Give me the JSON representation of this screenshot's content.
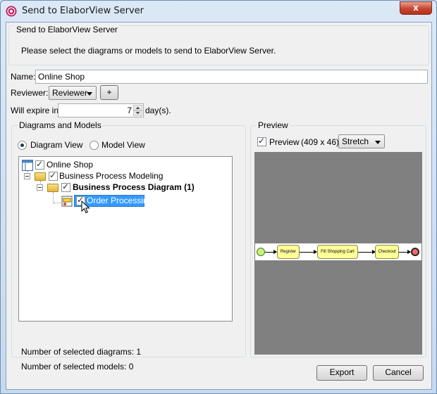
{
  "window": {
    "title": "Send to ElaborView Server",
    "close_label": "x"
  },
  "header": {
    "legend": "Send to ElaborView Server",
    "description": "Please select the diagrams or models to send to ElaborView Server."
  },
  "form": {
    "name_label": "Name:",
    "name_value": "Online Shop",
    "reviewer_label": "Reviewer:",
    "reviewer_value": "Reviewer",
    "add_label": "+",
    "expire_label": "Will expire in",
    "expire_value": "7",
    "expire_unit": "day(s)."
  },
  "diagrams_models": {
    "legend": "Diagrams and Models",
    "view_options": [
      "Diagram View",
      "Model View"
    ],
    "selected_view": "Diagram View",
    "tree": [
      {
        "label": "Online Shop",
        "checked": true,
        "bold": false
      },
      {
        "label": "Business Process Modeling",
        "checked": true,
        "bold": false
      },
      {
        "label": "Business Process Diagram (1)",
        "checked": true,
        "bold": true
      },
      {
        "label": "Order Processing",
        "checked": true,
        "bold": false,
        "selected": true
      }
    ],
    "selected_diagrams_text": "Number of selected diagrams: 1",
    "selected_models_text": "Number of selected models: 0"
  },
  "preview": {
    "legend": "Preview",
    "checkbox_label": "Preview",
    "checked": true,
    "dimensions": "(409 x 46)",
    "scale_mode": "Stretch",
    "diagram_tasks": [
      "Register",
      "Fill Shopping Cart",
      "Checkout"
    ]
  },
  "buttons": {
    "export": "Export",
    "cancel": "Cancel"
  },
  "colors": {
    "selection": "#3399ff",
    "task_fill": "#ffff99",
    "start_event": "#c8f07a",
    "end_event": "#f26a6a",
    "preview_bg": "#808080"
  }
}
